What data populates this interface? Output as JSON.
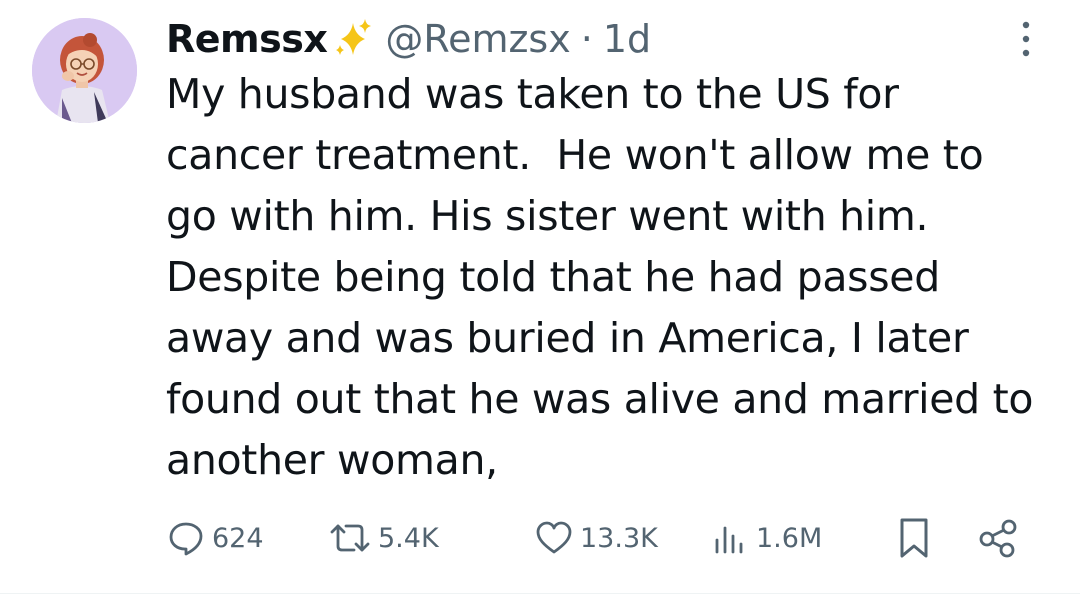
{
  "tweet": {
    "display_name": "Remssx",
    "handle": "@Remzsx",
    "separator": "·",
    "time_ago": "1d",
    "text": "My husband was taken to the US for\ncancer treatment.  He won't allow me to\ngo with him. His sister went with him.\nDespite being told that he had passed\naway and was buried in America, I later\nfound out that he was alive and married to\nanother woman,"
  },
  "actions": {
    "replies": "624",
    "reposts": "5.4K",
    "likes": "13.3K",
    "views": "1.6M"
  },
  "icons": {
    "badge": "sparkles-icon",
    "more": "more-vertical-icon",
    "reply": "reply-icon",
    "repost": "repost-icon",
    "like": "heart-icon",
    "views": "views-chart-icon",
    "bookmark": "bookmark-icon",
    "share": "share-icon"
  },
  "colors": {
    "text_primary": "#0f1419",
    "text_secondary": "#536471",
    "sparkle": "#f5c518",
    "avatar_bg": "#d9c9f2"
  }
}
